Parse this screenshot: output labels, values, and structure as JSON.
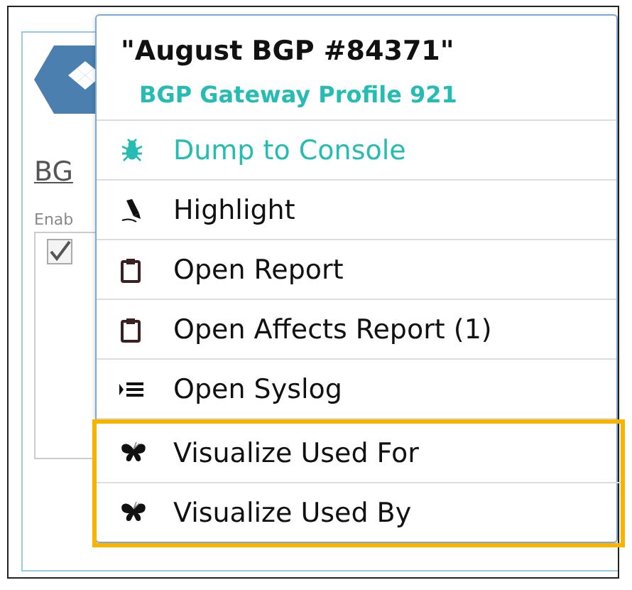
{
  "background": {
    "heading": "BG",
    "field_label": "Enab",
    "checkbox": {
      "checked": true
    }
  },
  "context_menu": {
    "title": "\"August BGP #84371\"",
    "subtitle": "BGP Gateway Profile 921",
    "items": [
      {
        "label": "Dump to Console",
        "kind": "debug",
        "color": "#26bcb4",
        "emphasized": false
      },
      {
        "label": "Highlight",
        "kind": "highlight",
        "color": "#111111",
        "emphasized": false
      },
      {
        "label": "Open Report",
        "kind": "report",
        "color": "#111111",
        "emphasized": false
      },
      {
        "label": "Open Affects Report (1)",
        "kind": "report",
        "color": "#111111",
        "emphasized": false
      },
      {
        "label": "Open Syslog",
        "kind": "syslog",
        "color": "#111111",
        "emphasized": false
      },
      {
        "label": "Visualize Used For",
        "kind": "visualize",
        "color": "#111111",
        "emphasized": true
      },
      {
        "label": "Visualize Used By",
        "kind": "visualize",
        "color": "#111111",
        "emphasized": true
      }
    ]
  }
}
